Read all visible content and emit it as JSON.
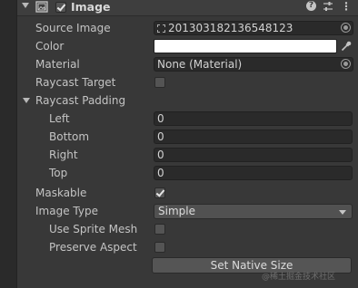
{
  "component": {
    "title": "Image",
    "enabled": true
  },
  "fields": {
    "source_image": {
      "label": "Source Image",
      "value": "201303182136548123"
    },
    "color": {
      "label": "Color",
      "value": "#ffffff"
    },
    "material": {
      "label": "Material",
      "value": "None (Material)"
    },
    "raycast_target": {
      "label": "Raycast Target",
      "checked": false
    },
    "raycast_padding": {
      "label": "Raycast Padding",
      "left": {
        "label": "Left",
        "value": "0"
      },
      "bottom": {
        "label": "Bottom",
        "value": "0"
      },
      "right": {
        "label": "Right",
        "value": "0"
      },
      "top": {
        "label": "Top",
        "value": "0"
      }
    },
    "maskable": {
      "label": "Maskable",
      "checked": true
    },
    "image_type": {
      "label": "Image Type",
      "value": "Simple"
    },
    "use_sprite_mesh": {
      "label": "Use Sprite Mesh",
      "checked": false
    },
    "preserve_aspect": {
      "label": "Preserve Aspect",
      "checked": false
    }
  },
  "buttons": {
    "set_native_size": "Set Native Size"
  },
  "watermark": "@稀土掘金技术社区",
  "icons": {
    "foldout": "chevron-down-icon",
    "component": "image-component-icon",
    "help": "help-icon",
    "preset": "sliders-icon",
    "menu": "kebab-menu-icon",
    "picker": "object-picker-icon",
    "eyedropper": "eyedropper-icon"
  }
}
